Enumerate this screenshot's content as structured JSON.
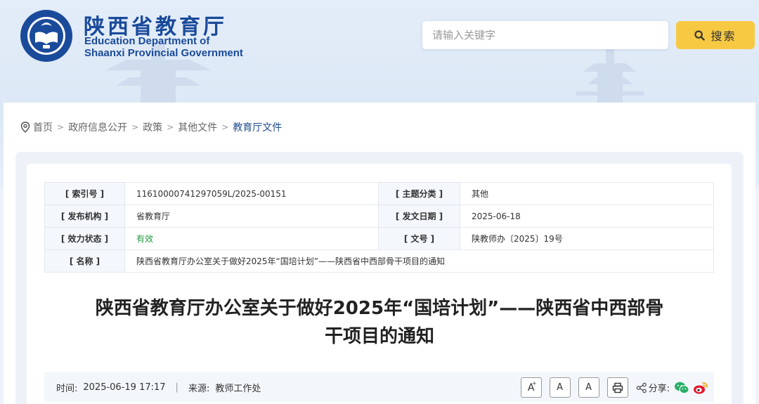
{
  "header": {
    "brand_cn": "陕西省教育厅",
    "brand_en_line1": "Education Department of",
    "brand_en_line2": "Shaanxi Provincial Government",
    "logo_icon": "eds-seal-icon",
    "search_placeholder": "请输入关键字",
    "search_button_label": "搜索",
    "colors": {
      "brand": "#1a4a9a",
      "search_button": "#f7c943"
    }
  },
  "breadcrumb": {
    "items": [
      "首页",
      "政府信息公开",
      "政策",
      "其他文件",
      "教育厅文件"
    ],
    "separator": ">"
  },
  "info": {
    "index_label": "[ 索引号 ]",
    "index_value": "11610000741297059L/2025-00151",
    "topic_label": "[ 主题分类 ]",
    "topic_value": "其他",
    "publisher_label": "[ 发布机构 ]",
    "publisher_value": "省教育厅",
    "date_label": "[ 发文日期 ]",
    "date_value": "2025-06-18",
    "status_label": "[ 效力状态 ]",
    "status_value": "有效",
    "doc_no_label": "[ 文号 ]",
    "doc_no_value": "陕教师办〔2025〕19号",
    "name_label": "[ 名称 ]",
    "name_value": "陕西省教育厅办公室关于做好2025年“国培计划”——陕西省中西部骨干项目的通知"
  },
  "article": {
    "title_line1": "陕西省教育厅办公室关于做好2025年“国培计划”——陕西省中西部骨",
    "title_line2": "干项目的通知"
  },
  "meta": {
    "time_label": "时间:",
    "time_value": "2025-06-19 17:17",
    "divider": "|",
    "source_label": "来源:",
    "source_value": "教师工作处",
    "font_large": "A",
    "font_large_sup": "+",
    "font_medium": "A",
    "font_small": "A",
    "share_label": "分享:"
  }
}
